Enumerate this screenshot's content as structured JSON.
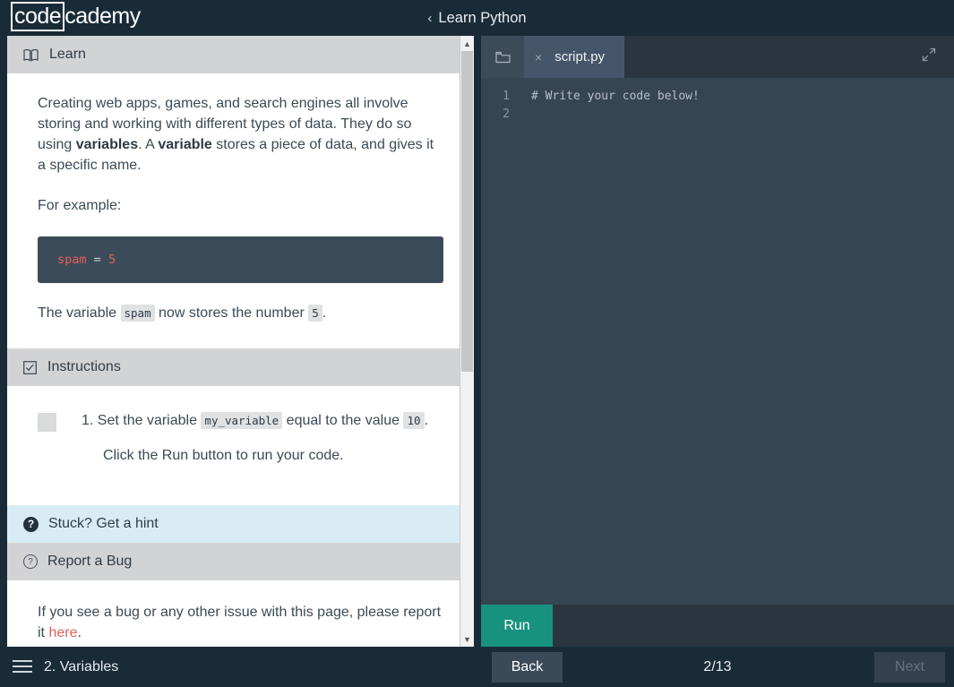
{
  "header": {
    "logo_boxed": "code",
    "logo_rest": "cademy",
    "back_chevron": "‹",
    "course_title": "Learn Python"
  },
  "learn": {
    "section_title": "Learn",
    "icon": "book-icon",
    "paragraph1_parts": [
      "Creating web apps, games, and search engines all involve storing and working with different types of data. They do so using ",
      "variables",
      ". A ",
      "variable",
      " stores a piece of data, and gives it a specific name."
    ],
    "paragraph2": "For example:",
    "code_example": {
      "variable": "spam",
      "operator": "=",
      "value": "5"
    },
    "paragraph3_parts": [
      "The variable ",
      "spam",
      " now stores the number ",
      "5",
      "."
    ]
  },
  "instructions": {
    "section_title": "Instructions",
    "icon": "checkbox-icon",
    "item_number": "1.",
    "item_parts": [
      "Set the variable ",
      "my_variable",
      " equal to the value ",
      "10",
      "."
    ],
    "sub_text": "Click the Run button to run your code."
  },
  "hint": {
    "label": "Stuck? Get a hint",
    "icon_glyph": "?"
  },
  "bug": {
    "label": "Report a Bug",
    "icon_glyph": "?",
    "body_prefix": "If you see a bug or any other issue with this page, please report it ",
    "link_text": "here",
    "body_suffix": "."
  },
  "editor": {
    "folder_icon": "folder-icon",
    "close_glyph": "×",
    "tab_name": "script.py",
    "expand_icon": "expand-icon",
    "lines": [
      {
        "number": "1",
        "text": "# Write your code below!"
      },
      {
        "number": "2",
        "text": ""
      }
    ],
    "run_label": "Run"
  },
  "footer": {
    "menu_icon": "hamburger-icon",
    "lesson_name": "2. Variables",
    "back_label": "Back",
    "progress": "2/13",
    "next_label": "Next"
  },
  "colors": {
    "app_background": "#1a2b38",
    "editor_background": "#364552",
    "run_accent": "#17927f",
    "code_red": "#e0615b",
    "hint_background": "#d9ecf5",
    "section_header": "#d2d3d5"
  }
}
